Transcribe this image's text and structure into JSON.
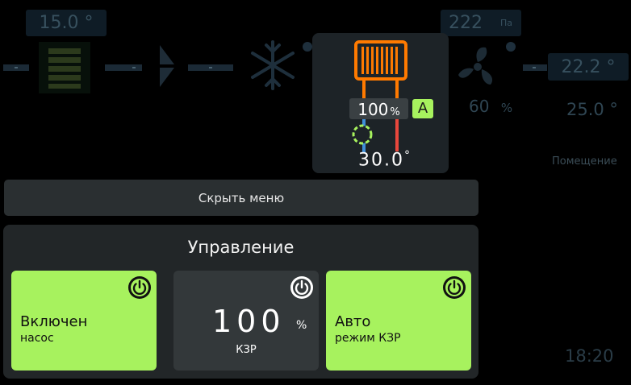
{
  "background_scheme": {
    "supply_temp": "15.0 °",
    "pressure": {
      "value": "222",
      "unit": "Па"
    },
    "fan_speed": {
      "value": "60",
      "unit": "%"
    },
    "room_temp_box": "22.2 °",
    "room_setpoint": "25.0 °",
    "room_label": "Помещение",
    "clock": "18:20"
  },
  "heater": {
    "valve_percent": "100",
    "percent_unit": "%",
    "mode_badge": "A",
    "water_temp": "30.0",
    "degree": "°"
  },
  "hide_menu_label": "Скрыть меню",
  "control": {
    "title": "Управление",
    "cards": [
      {
        "title": "Включен",
        "subtitle": "насос",
        "active": true
      },
      {
        "value": "100",
        "unit": "%",
        "subtitle": "КЗР",
        "active": false
      },
      {
        "title": "Авто",
        "subtitle": "режим КЗР",
        "active": true
      }
    ]
  },
  "colors": {
    "accent_green": "#a7f25e",
    "heater_orange": "#ff7a00",
    "pipe_red": "#e8473c",
    "pipe_blue": "#3f8fd8",
    "panel_grey": "#222628"
  }
}
